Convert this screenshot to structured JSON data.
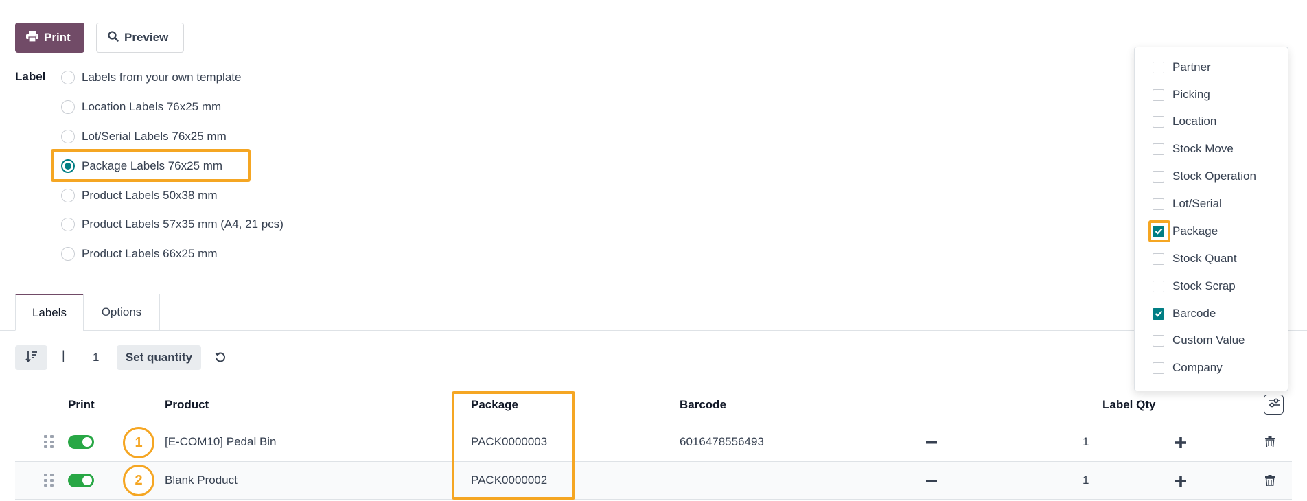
{
  "actions": {
    "print_label": "Print",
    "preview_label": "Preview"
  },
  "label_field": {
    "title": "Label",
    "options": [
      "Labels from your own template",
      "Location Labels 76x25 mm",
      "Lot/Serial Labels 76x25 mm",
      "Package Labels 76x25 mm",
      "Product Labels 50x38 mm",
      "Product Labels 57x35 mm (A4, 21 pcs)",
      "Product Labels 66x25 mm"
    ],
    "selected": "Package Labels 76x25 mm"
  },
  "tabs": [
    {
      "label": "Labels",
      "active": true
    },
    {
      "label": "Options",
      "active": false
    }
  ],
  "toolbar": {
    "separator": "|",
    "quantity": "1",
    "set_quantity_label": "Set quantity"
  },
  "table": {
    "headers": {
      "print": "Print",
      "product": "Product",
      "package": "Package",
      "barcode": "Barcode",
      "label_qty": "Label Qty"
    },
    "rows": [
      {
        "marker": "1",
        "print": true,
        "product": "[E-COM10] Pedal Bin",
        "package": "PACK0000003",
        "barcode": "6016478556493",
        "qty": "1"
      },
      {
        "marker": "2",
        "print": true,
        "product": "Blank Product",
        "package": "PACK0000002",
        "barcode": "",
        "qty": "1"
      }
    ]
  },
  "column_menu": {
    "items": [
      {
        "label": "Partner",
        "checked": false
      },
      {
        "label": "Picking",
        "checked": false
      },
      {
        "label": "Location",
        "checked": false
      },
      {
        "label": "Stock Move",
        "checked": false
      },
      {
        "label": "Stock Operation",
        "checked": false
      },
      {
        "label": "Lot/Serial",
        "checked": false
      },
      {
        "label": "Package",
        "checked": true
      },
      {
        "label": "Stock Quant",
        "checked": false
      },
      {
        "label": "Stock Scrap",
        "checked": false
      },
      {
        "label": "Barcode",
        "checked": true
      },
      {
        "label": "Custom Value",
        "checked": false
      },
      {
        "label": "Company",
        "checked": false
      }
    ]
  },
  "colors": {
    "brand": "#714b67",
    "accent": "#017e84",
    "highlight": "#f5a623",
    "toggle_on": "#28a745"
  },
  "icons": [
    "printer-icon",
    "search-icon",
    "sort-icon",
    "reset-icon",
    "drag-handle-icon",
    "minus-icon",
    "plus-icon",
    "trash-icon",
    "column-settings-icon",
    "check-icon"
  ]
}
